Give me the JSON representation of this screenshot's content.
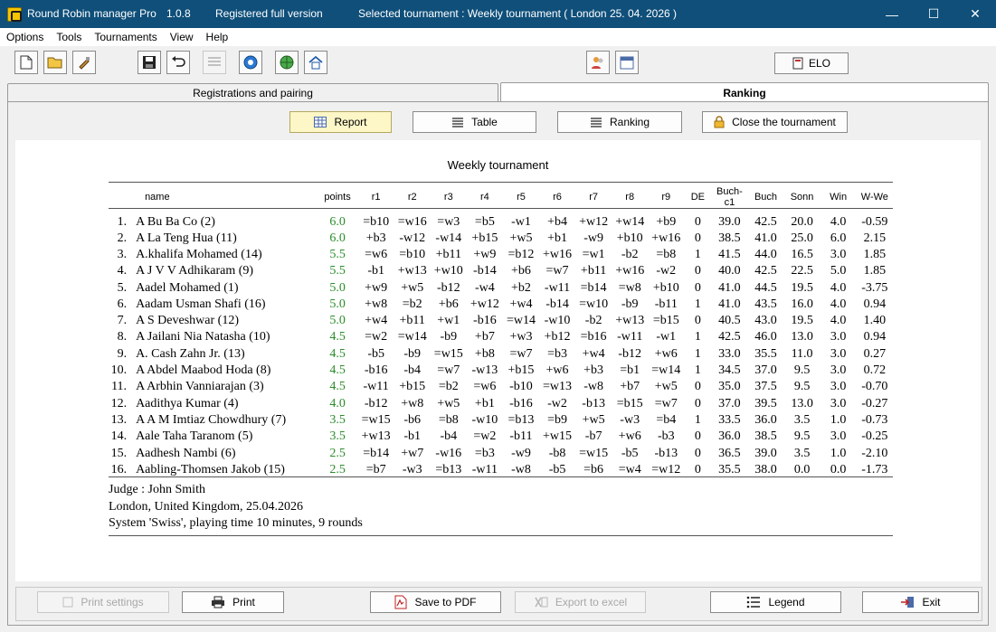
{
  "titlebar": {
    "app_name": "Round Robin manager Pro",
    "version": "1.0.8",
    "license": "Registered full version",
    "selected": "Selected tournament : Weekly tournament  ( London 25. 04. 2026 )",
    "minimize": "—",
    "maximize": "☐",
    "close": "✕"
  },
  "menu": [
    "Options",
    "Tools",
    "Tournaments",
    "View",
    "Help"
  ],
  "toolbar": {
    "elo_label": "ELO"
  },
  "tabs": {
    "registrations": "Registrations and pairing",
    "ranking": "Ranking"
  },
  "view_buttons": {
    "report": "Report",
    "table": "Table",
    "ranking": "Ranking",
    "close": "Close the tournament"
  },
  "report": {
    "title": "Weekly tournament",
    "headers": [
      "name",
      "points",
      "r1",
      "r2",
      "r3",
      "r4",
      "r5",
      "r6",
      "r7",
      "r8",
      "r9",
      "DE",
      "Buch-c1",
      "Buch",
      "Sonn",
      "Win",
      "W-We"
    ],
    "rows": [
      [
        "1.",
        "A Bu Ba Co (2)",
        "6.0",
        "=b10",
        "=w16",
        "=w3",
        "=b5",
        "-w1",
        "+b4",
        "+w12",
        "+w14",
        "+b9",
        "0",
        "39.0",
        "42.5",
        "20.0",
        "4.0",
        "-0.59"
      ],
      [
        "2.",
        "A La Teng Hua (11)",
        "6.0",
        "+b3",
        "-w12",
        "-w14",
        "+b15",
        "+w5",
        "+b1",
        "-w9",
        "+b10",
        "+w16",
        "0",
        "38.5",
        "41.0",
        "25.0",
        "6.0",
        "2.15"
      ],
      [
        "3.",
        "A.khalifa Mohamed (14)",
        "5.5",
        "=w6",
        "=b10",
        "+b11",
        "+w9",
        "=b12",
        "+w16",
        "=w1",
        "-b2",
        "=b8",
        "1",
        "41.5",
        "44.0",
        "16.5",
        "3.0",
        "1.85"
      ],
      [
        "4.",
        "A J V V Adhikaram (9)",
        "5.5",
        "-b1",
        "+w13",
        "+w10",
        "-b14",
        "+b6",
        "=w7",
        "+b11",
        "+w16",
        "-w2",
        "0",
        "40.0",
        "42.5",
        "22.5",
        "5.0",
        "1.85"
      ],
      [
        "5.",
        "Aadel Mohamed (1)",
        "5.0",
        "+w9",
        "+w5",
        "-b12",
        "-w4",
        "+b2",
        "-w11",
        "=b14",
        "=w8",
        "+b10",
        "0",
        "41.0",
        "44.5",
        "19.5",
        "4.0",
        "-3.75"
      ],
      [
        "6.",
        "Aadam Usman Shafi (16)",
        "5.0",
        "+w8",
        "=b2",
        "+b6",
        "+w12",
        "+w4",
        "-b14",
        "=w10",
        "-b9",
        "-b11",
        "1",
        "41.0",
        "43.5",
        "16.0",
        "4.0",
        "0.94"
      ],
      [
        "7.",
        "A S Deveshwar (12)",
        "5.0",
        "+w4",
        "+b11",
        "+w1",
        "-b16",
        "=w14",
        "-w10",
        "-b2",
        "+w13",
        "=b15",
        "0",
        "40.5",
        "43.0",
        "19.5",
        "4.0",
        "1.40"
      ],
      [
        "8.",
        "A Jailani Nia Natasha (10)",
        "4.5",
        "=w2",
        "=w14",
        "-b9",
        "+b7",
        "+w3",
        "+b12",
        "=b16",
        "-w11",
        "-w1",
        "1",
        "42.5",
        "46.0",
        "13.0",
        "3.0",
        "0.94"
      ],
      [
        "9.",
        "A. Cash Zahn Jr. (13)",
        "4.5",
        "-b5",
        "-b9",
        "=w15",
        "+b8",
        "=w7",
        "=b3",
        "+w4",
        "-b12",
        "+w6",
        "1",
        "33.0",
        "35.5",
        "11.0",
        "3.0",
        "0.27"
      ],
      [
        "10.",
        "A Abdel Maabod Hoda (8)",
        "4.5",
        "-b16",
        "-b4",
        "=w7",
        "-w13",
        "+b15",
        "+w6",
        "+b3",
        "=b1",
        "=w14",
        "1",
        "34.5",
        "37.0",
        "9.5",
        "3.0",
        "0.72"
      ],
      [
        "11.",
        "A Arbhin Vanniarajan (3)",
        "4.5",
        "-w11",
        "+b15",
        "=b2",
        "=w6",
        "-b10",
        "=w13",
        "-w8",
        "+b7",
        "+w5",
        "0",
        "35.0",
        "37.5",
        "9.5",
        "3.0",
        "-0.70"
      ],
      [
        "12.",
        "Aadithya Kumar (4)",
        "4.0",
        "-b12",
        "+w8",
        "+w5",
        "+b1",
        "-b16",
        "-w2",
        "-b13",
        "=b15",
        "=w7",
        "0",
        "37.0",
        "39.5",
        "13.0",
        "3.0",
        "-0.27"
      ],
      [
        "13.",
        "A A M Imtiaz Chowdhury (7)",
        "3.5",
        "=w15",
        "-b6",
        "=b8",
        "-w10",
        "=b13",
        "=b9",
        "+w5",
        "-w3",
        "=b4",
        "1",
        "33.5",
        "36.0",
        "3.5",
        "1.0",
        "-0.73"
      ],
      [
        "14.",
        "Aale Taha Taranom (5)",
        "3.5",
        "+w13",
        "-b1",
        "-b4",
        "=w2",
        "-b11",
        "+w15",
        "-b7",
        "+w6",
        "-b3",
        "0",
        "36.0",
        "38.5",
        "9.5",
        "3.0",
        "-0.25"
      ],
      [
        "15.",
        "Aadhesh Nambi (6)",
        "2.5",
        "=b14",
        "+w7",
        "-w16",
        "=b3",
        "-w9",
        "-b8",
        "=w15",
        "-b5",
        "-b13",
        "0",
        "36.5",
        "39.0",
        "3.5",
        "1.0",
        "-2.10"
      ],
      [
        "16.",
        "Aabling-Thomsen Jakob (15)",
        "2.5",
        "=b7",
        "-w3",
        "=b13",
        "-w11",
        "-w8",
        "-b5",
        "=b6",
        "=w4",
        "=w12",
        "0",
        "35.5",
        "38.0",
        "0.0",
        "0.0",
        "-1.73"
      ]
    ],
    "judge": "Judge : John Smith",
    "location": "London, United Kingdom, 25.04.2026",
    "system": "System 'Swiss', playing time 10 minutes, 9 rounds"
  },
  "bottom_buttons": {
    "print_settings": "Print settings",
    "print": "Print",
    "save_pdf": "Save to PDF",
    "export_excel": "Export to excel",
    "legend": "Legend",
    "exit": "Exit"
  }
}
